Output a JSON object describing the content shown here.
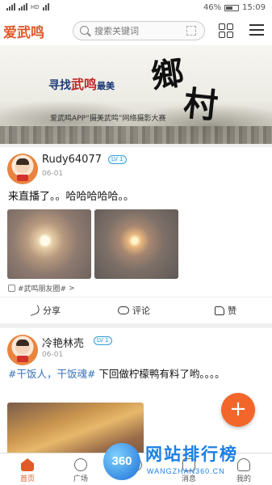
{
  "status_bar": {
    "battery": "46%",
    "time": "15:09",
    "network_tag": "HD"
  },
  "header": {
    "logo": "爱武鸣",
    "search_placeholder": "搜索关键词"
  },
  "banner": {
    "title_prefix": "寻找",
    "title_red": "武鸣",
    "title_suffix": "最美",
    "big_char_1": "鄉",
    "big_char_2": "村",
    "subtitle": "爱武鸣APP“摄美武鸣”网络摄影大赛"
  },
  "posts": [
    {
      "username": "Rudy64077",
      "level": "LV 1",
      "date": "06-01",
      "text": "来直播了。。哈哈哈哈哈。。",
      "topic": "#武鸣朋友圈#",
      "share_label": "分享",
      "comment_label": "评论",
      "like_label": "赞"
    },
    {
      "username": "冷艳林売",
      "level": "LV 1",
      "date": "06-01",
      "hashtag": "#干饭人，干饭魂#",
      "text": " 下回做柠檬鸭有料了哟。。。。"
    }
  ],
  "fab_label": "+",
  "bottom_nav": {
    "items": [
      {
        "label": "首页",
        "icon": "home-icon"
      },
      {
        "label": "广场",
        "icon": "square-icon"
      },
      {
        "label": "",
        "icon": "lens-icon"
      },
      {
        "label": "消息",
        "icon": "message-icon"
      },
      {
        "label": "我的",
        "icon": "profile-icon"
      }
    ]
  },
  "watermark": {
    "logo": "360",
    "title": "网站排行榜",
    "url": "WANGZHAN360.CN"
  },
  "colors": {
    "accent": "#e05a2a",
    "fab": "#f2662a",
    "level_badge": "#3aa0d8",
    "hashtag": "#3a72b8"
  }
}
